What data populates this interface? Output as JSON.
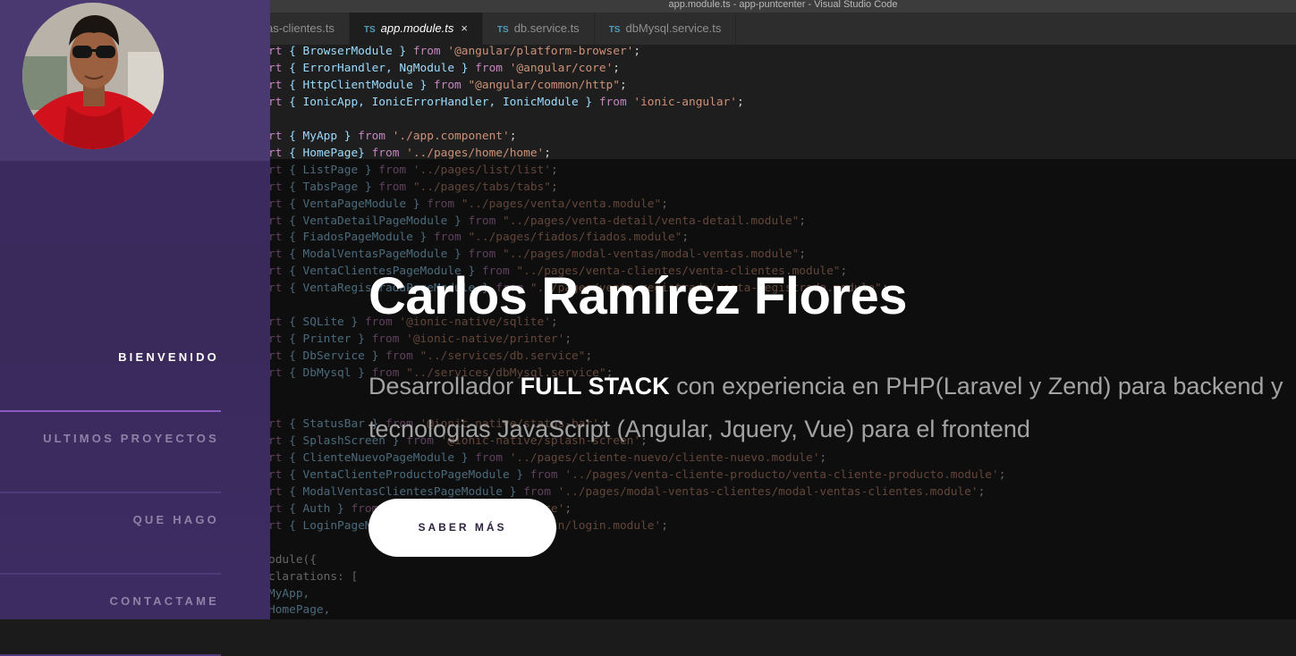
{
  "profile": {
    "avatar_alt": "Carlos Ramírez Flores"
  },
  "nav": {
    "items": [
      {
        "label": "BIENVENIDO",
        "active": true
      },
      {
        "label": "ULTIMOS PROYECTOS",
        "active": false
      },
      {
        "label": "QUE HAGO",
        "active": false
      },
      {
        "label": "CONTACTAME",
        "active": false
      }
    ]
  },
  "editor": {
    "window_title": "app.module.ts - app-puntcenter - Visual Studio Code",
    "tabs": [
      {
        "label": "as-clientes.ts",
        "icon": "ts-icon"
      },
      {
        "label": "app.module.ts",
        "icon": "ts-icon",
        "active": true
      },
      {
        "label": "db.service.ts",
        "icon": "ts-icon"
      },
      {
        "label": "dbMysql.service.ts",
        "icon": "ts-icon"
      }
    ],
    "tab_badge": "TS",
    "close_glyph": "×"
  },
  "hero": {
    "name": "Carlos Ramírez Flores",
    "desc_before": "Desarrollador ",
    "desc_bold": "FULL STACK",
    "desc_after": " con experiencia en PHP(Laravel y Zend) para backend y tecnologias JavaScript (Angular, Jquery, Vue) para el frontend",
    "cta": "SABER MÁS"
  },
  "colors": {
    "sidebar": "#3a2b5e",
    "sidebar_top": "#4a3870",
    "accent_line": "#8a5cc2",
    "button_bg": "#ffffff"
  }
}
